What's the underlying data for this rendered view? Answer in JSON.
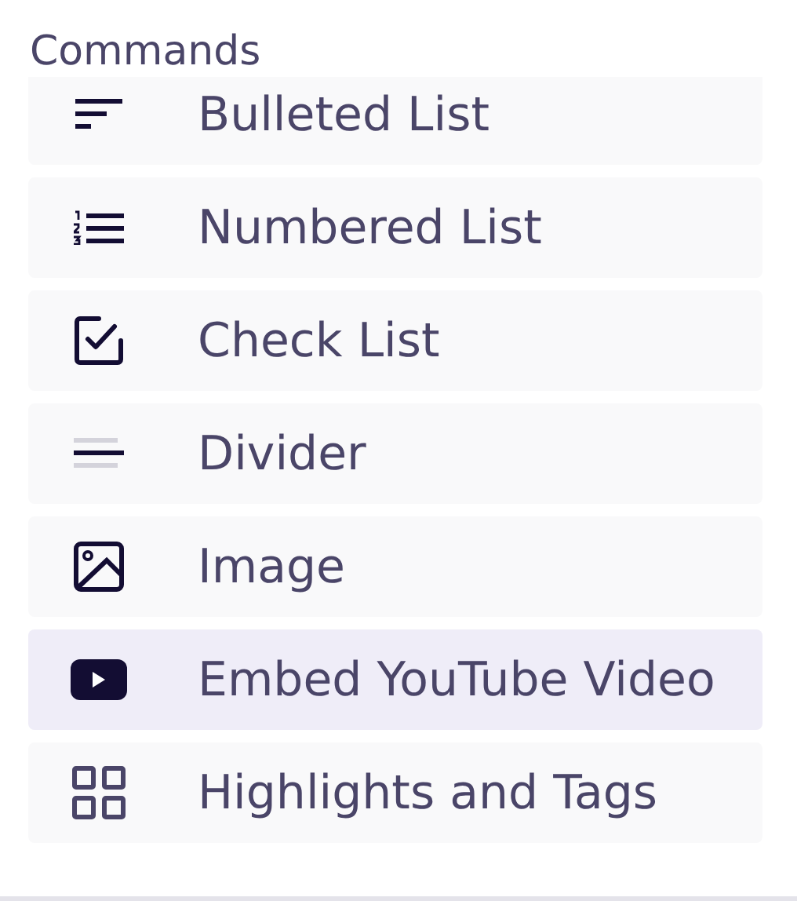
{
  "heading": "Commands",
  "items": [
    {
      "label": "Bulleted List",
      "kind": "bullets",
      "selected": false
    },
    {
      "label": "Numbered List",
      "kind": "numbers",
      "selected": false
    },
    {
      "label": "Check List",
      "kind": "check",
      "selected": false
    },
    {
      "label": "Divider",
      "kind": "divider",
      "selected": false
    },
    {
      "label": "Image",
      "kind": "image",
      "selected": false
    },
    {
      "label": "Embed YouTube Video",
      "kind": "video",
      "selected": true
    },
    {
      "label": "Highlights and Tags",
      "kind": "grid",
      "selected": false
    }
  ]
}
